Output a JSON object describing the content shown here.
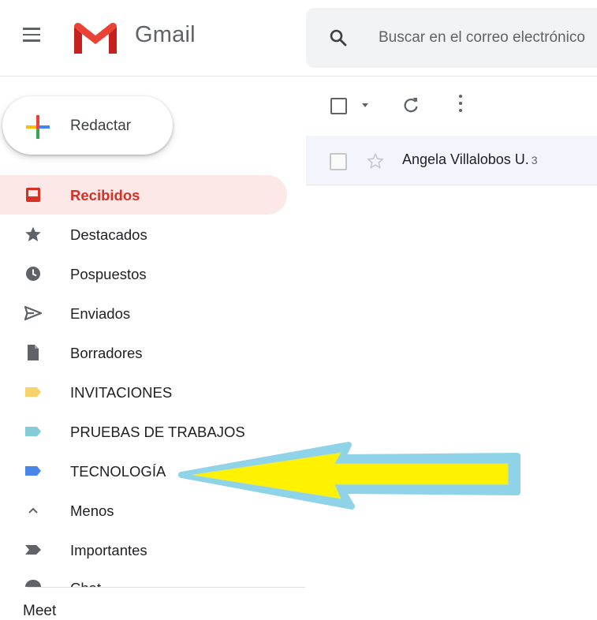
{
  "header": {
    "brand": "Gmail",
    "search_placeholder": "Buscar en el correo electrónico"
  },
  "compose": {
    "label": "Redactar"
  },
  "sidebar": {
    "items": [
      {
        "label": "Recibidos",
        "icon": "inbox-icon",
        "active": true
      },
      {
        "label": "Destacados",
        "icon": "star-icon"
      },
      {
        "label": "Pospuestos",
        "icon": "clock-icon"
      },
      {
        "label": "Enviados",
        "icon": "send-icon"
      },
      {
        "label": "Borradores",
        "icon": "draft-icon"
      },
      {
        "label": "INVITACIONES",
        "icon": "label-icon",
        "color": "#f7d46b"
      },
      {
        "label": "PRUEBAS DE TRABAJOS",
        "icon": "label-icon",
        "color": "#86cbd8"
      },
      {
        "label": "TECNOLOGÍA",
        "icon": "label-icon",
        "color": "#4a86e8"
      },
      {
        "label": "Menos",
        "icon": "chevron-up-icon"
      },
      {
        "label": "Importantes",
        "icon": "important-icon"
      }
    ],
    "partial_item": "Chat",
    "meet_label": "Meet"
  },
  "toolbar": {
    "icons": [
      "select-checkbox",
      "select-caret-icon",
      "refresh-icon",
      "more-vert-icon"
    ]
  },
  "emails": [
    {
      "sender": "Angela Villalobos U.",
      "count": "3"
    }
  ],
  "colors": {
    "accent_red": "#d93025",
    "active_bg": "#fce8e6",
    "annotation_arrow_fill": "#fff200",
    "annotation_arrow_outline": "#8fd3e8"
  }
}
